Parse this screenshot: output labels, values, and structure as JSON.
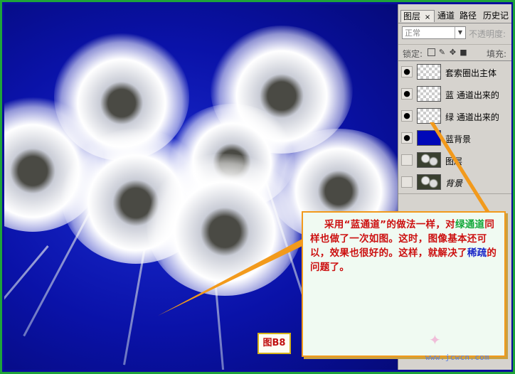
{
  "panel": {
    "tabs": [
      "图层",
      "×",
      "通道",
      "路径",
      "历史记"
    ],
    "blend_mode": "正常",
    "opacity_label": "不透明度:",
    "lock_label": "锁定:",
    "fill_label": "填充:",
    "layers": [
      {
        "name": "套索圈出主体",
        "visible": true,
        "thumb": "checker",
        "italic": false
      },
      {
        "name": "蓝   通道出来的",
        "visible": true,
        "thumb": "checker",
        "italic": false
      },
      {
        "name": "绿   通道出来的",
        "visible": true,
        "thumb": "checker",
        "italic": false
      },
      {
        "name": "蓝背景",
        "visible": true,
        "thumb": "blue",
        "italic": false
      },
      {
        "name": "图层",
        "visible": false,
        "thumb": "pic",
        "italic": false
      },
      {
        "name": "背景",
        "visible": false,
        "thumb": "pic",
        "italic": true
      }
    ]
  },
  "callout": {
    "part1": "    采用“蓝通道”的做法一样，对",
    "part2": "绿通道",
    "part3": "同样也做了一次如图。这时，图像基本还可以，效果也很好的。这样，就解决了",
    "part4": "稀疏",
    "part5": "的问题了。"
  },
  "figure_label": "图B8",
  "watermark": "www.jcwcn.com",
  "colors": {
    "frame_border": "#1ea33a",
    "callout_border": "#f29a1c",
    "callout_text": "#cc1010"
  }
}
